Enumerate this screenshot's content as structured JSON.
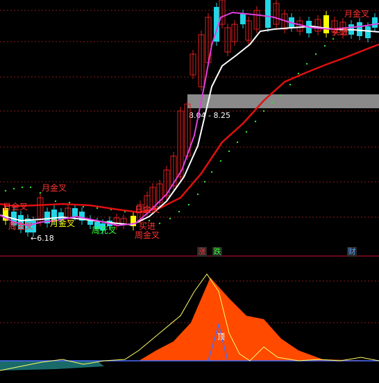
{
  "colors": {
    "background": "#000000",
    "grid": "#8b1a1a",
    "up_candle": "#e02020",
    "down_candle": "#22d6e6",
    "signal": "#ffff00",
    "ma_white": "#ffffff",
    "ma_magenta": "#e040e0",
    "ma_red": "#e01010",
    "dots": "#33dd33",
    "area_orange": "#ff4a00",
    "area_teal": "#1a6a6a",
    "band_gray": "#8a8a8a",
    "divider": "#d01030",
    "tag_red": "#ff3333",
    "tag_green": "#33ff33",
    "tag_blue": "#5aa0ff",
    "tag_bg": "#2a2a2a"
  },
  "price_panel": {
    "band_label": "8.04 - 8.25",
    "low_marker": "←6.18",
    "annotations": [
      {
        "text": "月金叉",
        "color": "#ff3333"
      },
      {
        "text": "周金叉",
        "color": "#ff3333"
      },
      {
        "text": "日金叉",
        "color": "#ff3333"
      },
      {
        "text": "月金叉",
        "color": "#ffff00"
      },
      {
        "text": "周死叉",
        "color": "#33ff33"
      },
      {
        "text": "日金叉",
        "color": "#ff3333"
      },
      {
        "text": "买进",
        "color": "#ff3333"
      },
      {
        "text": "周金叉",
        "color": "#ff3333"
      },
      {
        "text": "月金叉",
        "color": "#ff3333"
      },
      {
        "text": "买进",
        "color": "#ff3333"
      }
    ]
  },
  "tags": {
    "up": "涨",
    "down": "跌",
    "finance": "财"
  },
  "indicator_panel": {
    "peak_label": "顶"
  }
}
